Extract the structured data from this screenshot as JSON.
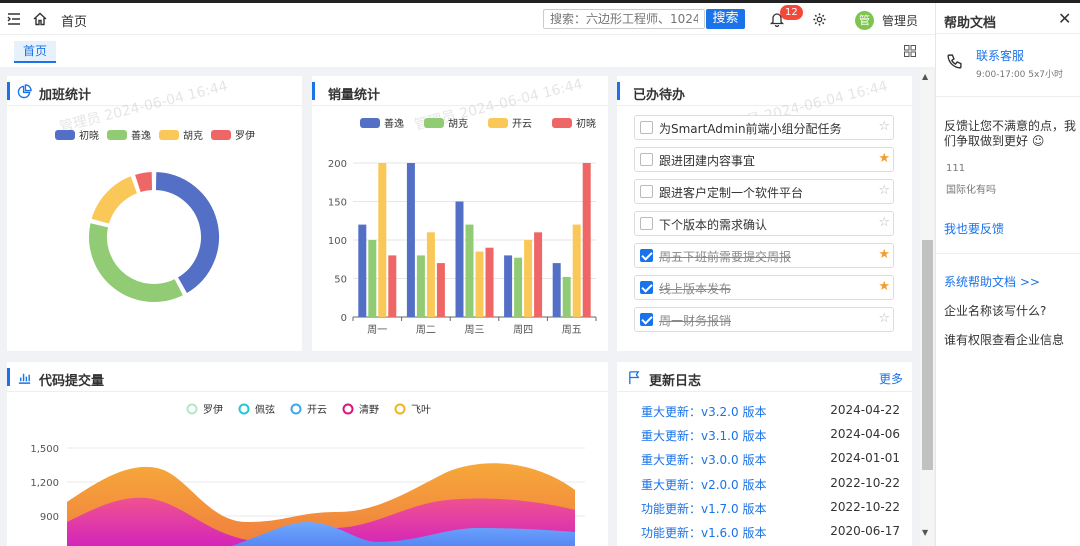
{
  "header": {
    "home_label": "首页",
    "search_placeholder": "搜索：六边形工程师、1024",
    "search_button": "搜索",
    "notification_count": "12",
    "avatar_char": "管",
    "user_name": "管理员"
  },
  "tabs": [
    {
      "label": "首页"
    }
  ],
  "watermark": "管理员 2024-06-04 16:44",
  "cards": {
    "overtime": {
      "title": "加班统计"
    },
    "sales": {
      "title": "销量统计"
    },
    "todo": {
      "title": "已办待办"
    },
    "code": {
      "title": "代码提交量"
    },
    "changelog": {
      "title": "更新日志",
      "more": "更多"
    }
  },
  "colors": {
    "blue": "#5470c6",
    "green": "#91cc75",
    "yellow": "#fac858",
    "red": "#ee6666",
    "accent": "#1a73e8"
  },
  "chart_data": [
    {
      "type": "pie",
      "legend": [
        "初晓",
        "善逸",
        "胡克",
        "罗伊"
      ],
      "values": [
        40,
        35,
        15,
        5
      ],
      "legend_position": "top"
    },
    {
      "type": "bar",
      "categories": [
        "周一",
        "周二",
        "周三",
        "周四",
        "周五"
      ],
      "series": [
        {
          "name": "善逸",
          "values": [
            120,
            200,
            150,
            80,
            70
          ]
        },
        {
          "name": "胡克",
          "values": [
            100,
            80,
            120,
            77,
            52
          ]
        },
        {
          "name": "开云",
          "values": [
            200,
            110,
            85,
            100,
            120
          ]
        },
        {
          "name": "初晓",
          "values": [
            80,
            70,
            90,
            110,
            200
          ]
        }
      ],
      "ylim": [
        0,
        200
      ],
      "yticks": [
        0,
        50,
        100,
        150,
        200
      ],
      "legend_position": "top",
      "grid": true
    },
    {
      "type": "area",
      "legend": [
        "罗伊",
        "佩弦",
        "开云",
        "清野",
        "飞叶"
      ],
      "yticks": [
        "900",
        "1,200",
        "1,500"
      ],
      "legend_position": "top"
    }
  ],
  "todos": [
    {
      "text": "为SmartAdmin前端小组分配任务",
      "done": false,
      "starred": false
    },
    {
      "text": "跟进团建内容事宜",
      "done": false,
      "starred": true
    },
    {
      "text": "跟进客户定制一个软件平台",
      "done": false,
      "starred": false
    },
    {
      "text": "下个版本的需求确认",
      "done": false,
      "starred": false
    },
    {
      "text": "周五下班前需要提交周报",
      "done": true,
      "starred": true
    },
    {
      "text": "线上版本发布",
      "done": true,
      "starred": true
    },
    {
      "text": "周一财务报销",
      "done": true,
      "starred": false
    }
  ],
  "changelog": [
    {
      "title": "重大更新：v3.2.0 版本",
      "date": "2024-04-22"
    },
    {
      "title": "重大更新：v3.1.0 版本",
      "date": "2024-04-06"
    },
    {
      "title": "重大更新：v3.0.0 版本",
      "date": "2024-01-01"
    },
    {
      "title": "重大更新：v2.0.0 版本",
      "date": "2022-10-22"
    },
    {
      "title": "功能更新：v1.7.0 版本",
      "date": "2022-10-22"
    },
    {
      "title": "功能更新：v1.6.0 版本",
      "date": "2020-06-17"
    }
  ],
  "help": {
    "title": "帮助文档",
    "contact": "联系客服",
    "hours": "9:00-17:00 5x7小时",
    "feedback_intro": "反馈让您不满意的点，我们争取做到更好 ☺",
    "sample_1": "111",
    "sample_2": "国际化有吗",
    "feedback_link": "我也要反馈",
    "docs_link": "系统帮助文档 >>",
    "faq_1": "企业名称该写什么?",
    "faq_2": "谁有权限查看企业信息"
  }
}
